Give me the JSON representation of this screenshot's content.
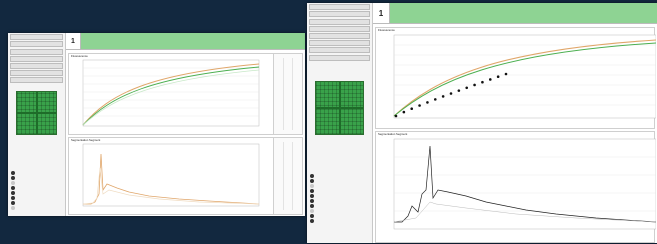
{
  "screen_left": {
    "well_number": "1",
    "panel_top_title": "Fluorescence",
    "panel_bottom_title": "Segmentation Segment"
  },
  "screen_right": {
    "well_number": "1",
    "panel_top_title": "Fluorescence",
    "panel_bottom_title": "Segmentation Segment"
  },
  "colors": {
    "background": "#12283f",
    "header_green": "#8ed393",
    "plate_green": "#39a24a",
    "curve_black": "#111111",
    "curve_green": "#4caf50",
    "curve_orange": "#e0a66a"
  },
  "icons": [
    "plate-icon",
    "legend-icon"
  ]
}
